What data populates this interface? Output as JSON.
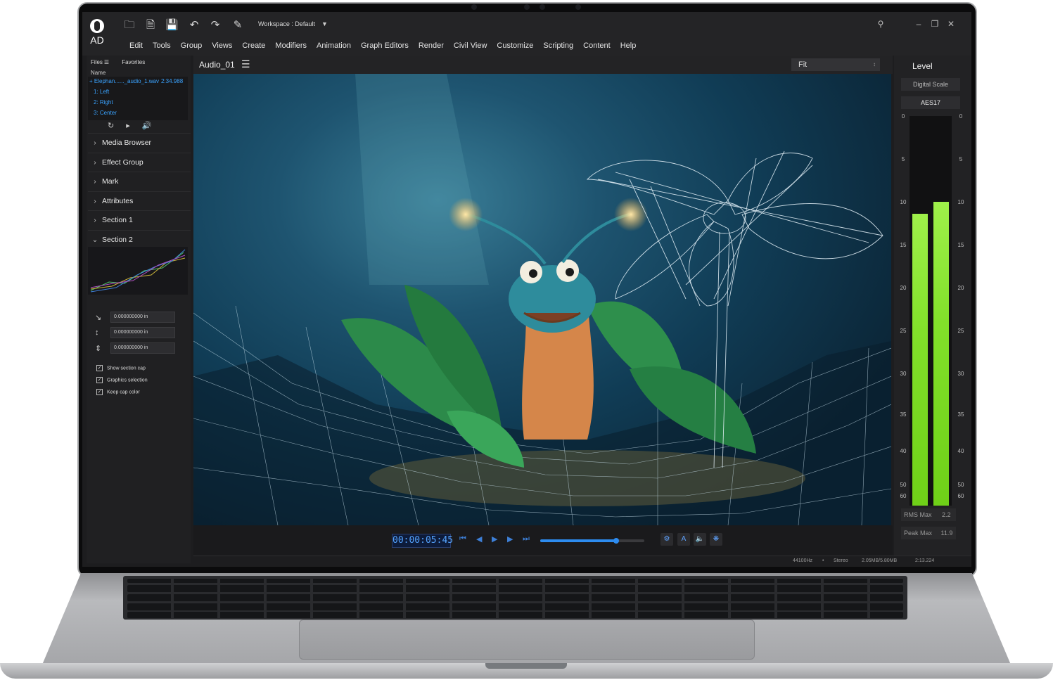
{
  "app": {
    "logo_text": "AD",
    "workspace_label": "Workspace : Default"
  },
  "menu": [
    "Edit",
    "Tools",
    "Group",
    "Views",
    "Create",
    "Modifiers",
    "Animation",
    "Graph Editors",
    "Render",
    "Civil View",
    "Customize",
    "Scripting",
    "Content",
    "Help"
  ],
  "left_panel": {
    "tabs": [
      "Files",
      "Favorites"
    ],
    "name_header": "Name",
    "file": {
      "name": "Elephan......_audio_1.wav",
      "duration": "2:34.988"
    },
    "channels": [
      "1: Left",
      "2: Right",
      "3: Center"
    ],
    "sections": [
      {
        "label": "Media Browser",
        "expanded": false
      },
      {
        "label": "Effect Group",
        "expanded": false
      },
      {
        "label": "Mark",
        "expanded": false
      },
      {
        "label": "Attributes",
        "expanded": false
      },
      {
        "label": "Section 1",
        "expanded": false
      },
      {
        "label": "Section 2",
        "expanded": true
      }
    ],
    "coordinates": [
      "0.000000000 in",
      "0.000000000 in",
      "0.000000000 in"
    ],
    "checkboxes": [
      {
        "label": "Show section cap",
        "checked": true
      },
      {
        "label": "Graphics selection",
        "checked": true
      },
      {
        "label": "Keep cap color",
        "checked": true
      }
    ]
  },
  "viewport": {
    "title": "Audio_01",
    "fit_value": "Fit"
  },
  "transport": {
    "timecode": "00:00:05:45",
    "progress": 0.73
  },
  "status": {
    "sample_rate": "44100Hz",
    "channels": "Stereo",
    "size": "2.05MB/5.80MB",
    "time": "2:13.224"
  },
  "level": {
    "title": "Level",
    "scale_mode": "Digital Scale",
    "standard": "AES17",
    "scale_ticks": [
      "0",
      "5",
      "10",
      "15",
      "20",
      "25",
      "30",
      "35",
      "40",
      "50",
      "60"
    ],
    "left_level": 0.75,
    "right_level": 0.78,
    "rms_max_label": "RMS Max",
    "rms_max_value": "2.2",
    "peak_max_label": "Peak Max",
    "peak_max_value": "11.9"
  },
  "colors": {
    "accent": "#2d8cf0",
    "meter_green": "#82e02a",
    "file_blue": "#3aa3ff"
  }
}
